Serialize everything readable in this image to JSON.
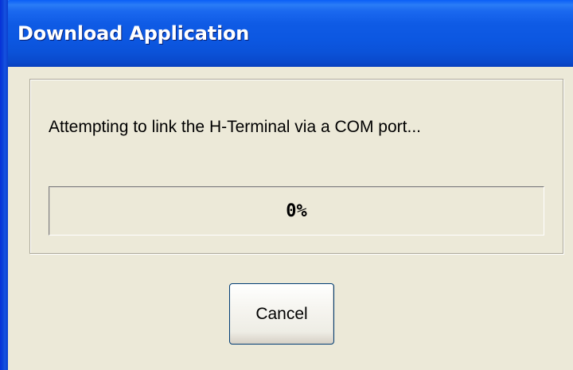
{
  "window": {
    "title": "Download Application"
  },
  "dialog": {
    "status_message": "Attempting to link the H-Terminal via a COM port...",
    "progress": {
      "value_percent": 0,
      "label": "0%"
    },
    "cancel_label": "Cancel"
  },
  "colors": {
    "titlebar": "#0c57e1",
    "dialog_background": "#ece9d8",
    "progress_fill": "#0a246a"
  }
}
